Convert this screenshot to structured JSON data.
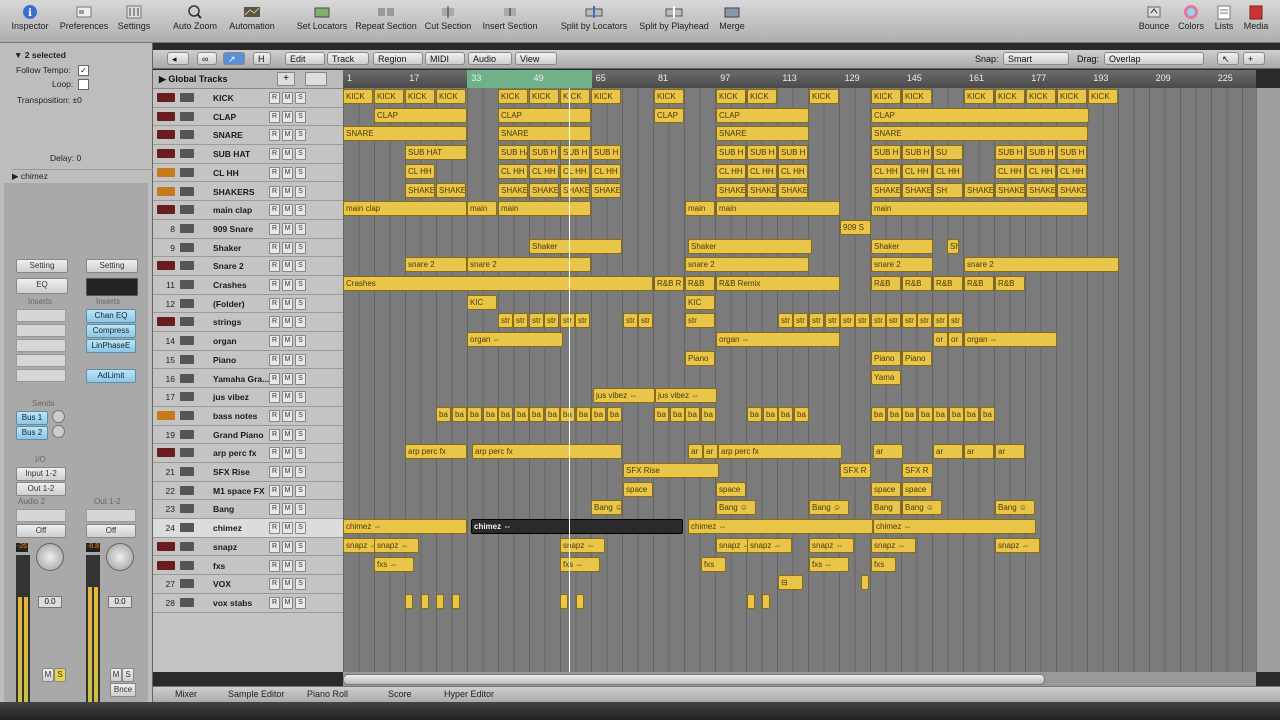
{
  "toolbar": {
    "inspector": "Inspector",
    "preferences": "Preferences",
    "settings": "Settings",
    "auto_zoom": "Auto Zoom",
    "automation": "Automation",
    "set_locators": "Set Locators",
    "repeat_section": "Repeat Section",
    "cut_section": "Cut Section",
    "insert_section": "Insert Section",
    "split_locators": "Split by Locators",
    "split_playhead": "Split by Playhead",
    "merge": "Merge",
    "bounce": "Bounce",
    "colors": "Colors",
    "lists": "Lists",
    "media": "Media"
  },
  "inspector": {
    "selected": "2 selected",
    "follow_tempo": "Follow Tempo:",
    "loop": "Loop:",
    "transposition": "Transposition:",
    "transposition_val": "±0",
    "delay": "Delay:",
    "delay_val": "0",
    "region_name": "chimez",
    "setting": "Setting",
    "eq": "EQ",
    "inserts": "Inserts",
    "plug1": "Chan EQ",
    "plug2": "Compress",
    "plug3": "LinPhaseE",
    "plug4": "AdLimit",
    "sends": "Sends",
    "bus1": "Bus 1",
    "bus2": "Bus 2",
    "io": "I/O",
    "input": "Input 1-2",
    "output": "Out 1-2",
    "audio2": "Audio 2",
    "out12": "Out 1-2",
    "off": "Off",
    "vol1": "-26",
    "vol2": "-8.8",
    "fader1": "0.0",
    "fader2": "0.0",
    "m": "M",
    "s": "S",
    "bnce": "Bnce"
  },
  "arrange": {
    "edit": "Edit",
    "track": "Track",
    "region": "Region",
    "midi": "MIDI",
    "audio": "Audio",
    "view": "View",
    "snap_label": "Snap:",
    "snap": "Smart",
    "drag_label": "Drag:",
    "drag": "Overlap",
    "global_tracks": "Global Tracks"
  },
  "ruler": [
    "1",
    "17",
    "33",
    "49",
    "65",
    "81",
    "97",
    "113",
    "129",
    "145",
    "161",
    "177",
    "193",
    "209",
    "225"
  ],
  "tracks": [
    {
      "num": "",
      "name": "KICK",
      "color": "#6a1d1d"
    },
    {
      "num": "",
      "name": "CLAP",
      "color": "#6a1d1d"
    },
    {
      "num": "",
      "name": "SNARE",
      "color": "#6a1d1d"
    },
    {
      "num": "",
      "name": "SUB HAT",
      "color": "#6a1d1d"
    },
    {
      "num": "",
      "name": "CL HH",
      "color": "#c87a1a"
    },
    {
      "num": "",
      "name": "SHAKERS",
      "color": "#c87a1a"
    },
    {
      "num": "",
      "name": "main clap",
      "color": "#6a1d1d"
    },
    {
      "num": "8",
      "name": "909 Snare",
      "color": ""
    },
    {
      "num": "9",
      "name": "Shaker",
      "color": ""
    },
    {
      "num": "",
      "name": "Snare 2",
      "color": "#6a1d1d"
    },
    {
      "num": "11",
      "name": "Crashes",
      "color": ""
    },
    {
      "num": "12",
      "name": "(Folder)",
      "color": ""
    },
    {
      "num": "",
      "name": "strings",
      "color": "#6a1d1d"
    },
    {
      "num": "14",
      "name": "organ",
      "color": ""
    },
    {
      "num": "15",
      "name": "Piano",
      "color": ""
    },
    {
      "num": "16",
      "name": "Yamaha Gra...",
      "color": ""
    },
    {
      "num": "17",
      "name": "jus vibez",
      "color": ""
    },
    {
      "num": "",
      "name": "bass notes",
      "color": "#c87a1a"
    },
    {
      "num": "19",
      "name": "Grand Piano",
      "color": ""
    },
    {
      "num": "",
      "name": "arp perc fx",
      "color": "#6a1d1d"
    },
    {
      "num": "21",
      "name": "SFX Rise",
      "color": ""
    },
    {
      "num": "22",
      "name": "M1 space FX",
      "color": ""
    },
    {
      "num": "23",
      "name": "Bang",
      "color": ""
    },
    {
      "num": "24",
      "name": "chimez",
      "color": "",
      "selected": true
    },
    {
      "num": "",
      "name": "snapz",
      "color": "#6a1d1d"
    },
    {
      "num": "",
      "name": "fxs",
      "color": "#6a1d1d"
    },
    {
      "num": "27",
      "name": "VOX",
      "color": ""
    },
    {
      "num": "28",
      "name": "vox stabs",
      "color": ""
    }
  ],
  "regions": [
    {
      "row": 0,
      "items": [
        [
          "KICK",
          0,
          30
        ],
        [
          "KICK",
          31,
          30
        ],
        [
          "KICK",
          62,
          30
        ],
        [
          "KICK",
          93,
          30
        ],
        [
          "KICK",
          155,
          30
        ],
        [
          "KICK",
          186,
          30
        ],
        [
          "KICK",
          217,
          30
        ],
        [
          "KICK",
          248,
          30
        ],
        [
          "KICK",
          311,
          30
        ],
        [
          "KICK",
          373,
          30
        ],
        [
          "KICK",
          404,
          30
        ],
        [
          "KICK",
          466,
          30
        ],
        [
          "KICK",
          528,
          30
        ],
        [
          "KICK",
          559,
          30
        ],
        [
          "KICK",
          621,
          30
        ],
        [
          "KICK",
          652,
          30
        ],
        [
          "KICK",
          683,
          30
        ],
        [
          "KICK",
          714,
          30
        ],
        [
          "KICK",
          745,
          30
        ]
      ]
    },
    {
      "row": 1,
      "items": [
        [
          "CLAP",
          31,
          93
        ],
        [
          "CLAP",
          155,
          93
        ],
        [
          "CLAP",
          311,
          30
        ],
        [
          "CLAP",
          373,
          93
        ],
        [
          "CLAP",
          528,
          218
        ]
      ]
    },
    {
      "row": 2,
      "items": [
        [
          "SNARE",
          0,
          124
        ],
        [
          "SNARE",
          155,
          93
        ],
        [
          "SNARE",
          373,
          93
        ],
        [
          "SNARE",
          528,
          217
        ]
      ]
    },
    {
      "row": 3,
      "items": [
        [
          "SUB HAT",
          62,
          62
        ],
        [
          "SUB HAT",
          155,
          30
        ],
        [
          "SUB H",
          186,
          30
        ],
        [
          "SUB H",
          217,
          30
        ],
        [
          "SUB H",
          248,
          30
        ],
        [
          "SUB H",
          373,
          30
        ],
        [
          "SUB H",
          404,
          30
        ],
        [
          "SUB H",
          435,
          30
        ],
        [
          "SUB H",
          528,
          30
        ],
        [
          "SUB H",
          559,
          30
        ],
        [
          "SU",
          590,
          30
        ],
        [
          "SUB H",
          652,
          30
        ],
        [
          "SUB H",
          683,
          30
        ],
        [
          "SUB H",
          714,
          30
        ]
      ]
    },
    {
      "row": 4,
      "items": [
        [
          "CL HH",
          62,
          30
        ],
        [
          "CL HH",
          155,
          30
        ],
        [
          "CL HH",
          186,
          30
        ],
        [
          "CL HH",
          217,
          30
        ],
        [
          "CL HH",
          248,
          30
        ],
        [
          "CL HH",
          373,
          30
        ],
        [
          "CL HH",
          404,
          30
        ],
        [
          "CL HH",
          435,
          30
        ],
        [
          "CL HH",
          528,
          30
        ],
        [
          "CL HH",
          559,
          30
        ],
        [
          "CL HH",
          590,
          30
        ],
        [
          "CL HH",
          652,
          30
        ],
        [
          "CL HH",
          683,
          30
        ],
        [
          "CL HH",
          714,
          30
        ]
      ]
    },
    {
      "row": 5,
      "items": [
        [
          "SHAKE",
          62,
          30
        ],
        [
          "SHAKE",
          93,
          30
        ],
        [
          "SHAKE",
          155,
          30
        ],
        [
          "SHAKE",
          186,
          30
        ],
        [
          "SHAKE",
          217,
          30
        ],
        [
          "SHAKE",
          248,
          30
        ],
        [
          "SHAKE",
          373,
          30
        ],
        [
          "SHAKE",
          404,
          30
        ],
        [
          "SHAKE",
          435,
          30
        ],
        [
          "SHAKE",
          528,
          30
        ],
        [
          "SHAKE",
          559,
          30
        ],
        [
          "SH",
          590,
          30
        ],
        [
          "SHAKE",
          621,
          30
        ],
        [
          "SHAKE",
          652,
          30
        ],
        [
          "SHAKE",
          683,
          30
        ],
        [
          "SHAKE",
          714,
          30
        ]
      ]
    },
    {
      "row": 6,
      "items": [
        [
          "main clap",
          0,
          124
        ],
        [
          "main",
          124,
          30
        ],
        [
          "main",
          155,
          93
        ],
        [
          "main",
          342,
          30
        ],
        [
          "main",
          373,
          124
        ],
        [
          "main",
          528,
          217
        ]
      ]
    },
    {
      "row": 7,
      "items": [
        [
          "909 S",
          497,
          31
        ]
      ]
    },
    {
      "row": 8,
      "items": [
        [
          "Shaker",
          186,
          93
        ],
        [
          "Shaker",
          345,
          124
        ],
        [
          "Shaker",
          528,
          62
        ],
        [
          "Sh",
          604,
          12
        ]
      ]
    },
    {
      "row": 9,
      "items": [
        [
          "snare 2",
          62,
          62
        ],
        [
          "snare 2",
          124,
          124
        ],
        [
          "snare 2",
          342,
          124
        ],
        [
          "snare 2",
          528,
          62
        ],
        [
          "snare 2",
          621,
          155
        ]
      ]
    },
    {
      "row": 10,
      "items": [
        [
          "Crashes",
          0,
          310
        ],
        [
          "R&B R",
          311,
          30
        ],
        [
          "R&B",
          342,
          30
        ],
        [
          "R&B Remix",
          373,
          124
        ],
        [
          "R&B",
          528,
          30
        ],
        [
          "R&B",
          559,
          30
        ],
        [
          "R&B",
          590,
          30
        ],
        [
          "R&B",
          621,
          30
        ],
        [
          "R&B",
          652,
          30
        ]
      ]
    },
    {
      "row": 11,
      "items": [
        [
          "KIC",
          124,
          30
        ],
        [
          "KIC",
          342,
          30
        ]
      ]
    },
    {
      "row": 12,
      "items": [
        [
          "str",
          155,
          15
        ],
        [
          "str",
          170,
          15
        ],
        [
          "str",
          186,
          15
        ],
        [
          "str",
          201,
          15
        ],
        [
          "str",
          217,
          15
        ],
        [
          "str",
          232,
          15
        ],
        [
          "str",
          280,
          15
        ],
        [
          "str",
          295,
          15
        ],
        [
          "str",
          342,
          30
        ],
        [
          "str",
          435,
          15
        ],
        [
          "str",
          450,
          15
        ],
        [
          "str",
          466,
          15
        ],
        [
          "str",
          482,
          15
        ],
        [
          "str",
          497,
          15
        ],
        [
          "str",
          512,
          15
        ],
        [
          "str",
          528,
          15
        ],
        [
          "str",
          543,
          15
        ],
        [
          "str",
          559,
          15
        ],
        [
          "str",
          574,
          15
        ],
        [
          "str",
          590,
          15
        ],
        [
          "str",
          605,
          15
        ]
      ]
    },
    {
      "row": 13,
      "items": [
        [
          "organ ⇔",
          124,
          96
        ],
        [
          "organ ⇔",
          373,
          124
        ],
        [
          "or",
          590,
          15
        ],
        [
          "or",
          605,
          15
        ],
        [
          "organ ⇔",
          621,
          93
        ]
      ]
    },
    {
      "row": 14,
      "items": [
        [
          "Piano",
          342,
          30
        ],
        [
          "Piano",
          528,
          30
        ],
        [
          "Piano",
          559,
          30
        ]
      ]
    },
    {
      "row": 15,
      "items": [
        [
          "Yama",
          528,
          30
        ]
      ]
    },
    {
      "row": 16,
      "items": [
        [
          "jus vibez ⇔",
          250,
          62
        ],
        [
          "jus vibez ⇔",
          312,
          62
        ]
      ]
    },
    {
      "row": 17,
      "items": [
        [
          "ba",
          93,
          15
        ],
        [
          "ba",
          109,
          15
        ],
        [
          "ba",
          124,
          15
        ],
        [
          "ba",
          140,
          15
        ],
        [
          "ba",
          155,
          15
        ],
        [
          "ba",
          171,
          15
        ],
        [
          "ba",
          186,
          15
        ],
        [
          "ba",
          202,
          15
        ],
        [
          "ba",
          217,
          15
        ],
        [
          "ba",
          233,
          15
        ],
        [
          "ba",
          248,
          15
        ],
        [
          "ba",
          264,
          15
        ],
        [
          "ba",
          311,
          15
        ],
        [
          "ba",
          327,
          15
        ],
        [
          "ba",
          342,
          15
        ],
        [
          "ba",
          358,
          15
        ],
        [
          "ba",
          404,
          15
        ],
        [
          "ba",
          420,
          15
        ],
        [
          "ba",
          435,
          15
        ],
        [
          "ba",
          451,
          15
        ],
        [
          "ba",
          528,
          15
        ],
        [
          "ba",
          544,
          15
        ],
        [
          "ba",
          559,
          15
        ],
        [
          "ba",
          575,
          15
        ],
        [
          "ba",
          590,
          15
        ],
        [
          "ba",
          606,
          15
        ],
        [
          "ba",
          621,
          15
        ],
        [
          "ba",
          637,
          15
        ]
      ]
    },
    {
      "row": 18,
      "items": []
    },
    {
      "row": 19,
      "items": [
        [
          "arp perc fx",
          62,
          62
        ],
        [
          "arp perc fx",
          129,
          150
        ],
        [
          "ar",
          345,
          15
        ],
        [
          "ar",
          360,
          15
        ],
        [
          "arp perc fx",
          375,
          124
        ],
        [
          "ar",
          530,
          30
        ],
        [
          "ar",
          590,
          30
        ],
        [
          "ar",
          621,
          30
        ],
        [
          "ar",
          652,
          30
        ]
      ]
    },
    {
      "row": 20,
      "items": [
        [
          "SFX Rise",
          280,
          96
        ],
        [
          "SFX R",
          497,
          31
        ],
        [
          "SFX R",
          559,
          31
        ]
      ]
    },
    {
      "row": 21,
      "items": [
        [
          "space",
          280,
          30
        ],
        [
          "space",
          373,
          30
        ],
        [
          "space",
          528,
          30
        ],
        [
          "space",
          559,
          30
        ]
      ]
    },
    {
      "row": 22,
      "items": [
        [
          "Bang ☺",
          248,
          31
        ],
        [
          "Bang ☺",
          373,
          40
        ],
        [
          "Bang ☺",
          466,
          40
        ],
        [
          "Bang",
          528,
          30
        ],
        [
          "Bang ☺",
          559,
          40
        ],
        [
          "Bang ☺",
          652,
          40
        ]
      ]
    },
    {
      "row": 23,
      "items": [
        [
          "chimez ⇔",
          0,
          124
        ],
        [
          "chimez ⇔",
          128,
          212,
          "dark"
        ],
        [
          "chimez ⇔",
          345,
          185
        ],
        [
          "chimez ⇔",
          530,
          163
        ]
      ]
    },
    {
      "row": 24,
      "items": [
        [
          "snapz ⇔",
          0,
          45
        ],
        [
          "snapz ⇔",
          31,
          45
        ],
        [
          "snapz ⇔",
          217,
          45
        ],
        [
          "snapz ⇔",
          373,
          45
        ],
        [
          "snapz ⇔",
          404,
          45
        ],
        [
          "snapz ⇔",
          466,
          45
        ],
        [
          "snapz ⇔",
          528,
          45
        ],
        [
          "snapz ⇔",
          652,
          45
        ]
      ]
    },
    {
      "row": 25,
      "items": [
        [
          "fxs ⇔",
          31,
          40
        ],
        [
          "fxs ⇔",
          217,
          40
        ],
        [
          "fxs",
          358,
          25
        ],
        [
          "fxs ⇔",
          466,
          40
        ],
        [
          "fxs",
          528,
          25
        ]
      ]
    },
    {
      "row": 26,
      "items": [
        [
          "⊟",
          435,
          25
        ],
        [
          "",
          518,
          8
        ]
      ]
    },
    {
      "row": 27,
      "items": [
        [
          "",
          62,
          8
        ],
        [
          "",
          78,
          8
        ],
        [
          "",
          93,
          8
        ],
        [
          "",
          109,
          8
        ],
        [
          "",
          217,
          8
        ],
        [
          "",
          233,
          8
        ],
        [
          "",
          404,
          8
        ],
        [
          "",
          419,
          8
        ]
      ]
    }
  ],
  "bottom_tabs": [
    "Mixer",
    "Sample Editor",
    "Piano Roll",
    "Score",
    "Hyper Editor"
  ]
}
